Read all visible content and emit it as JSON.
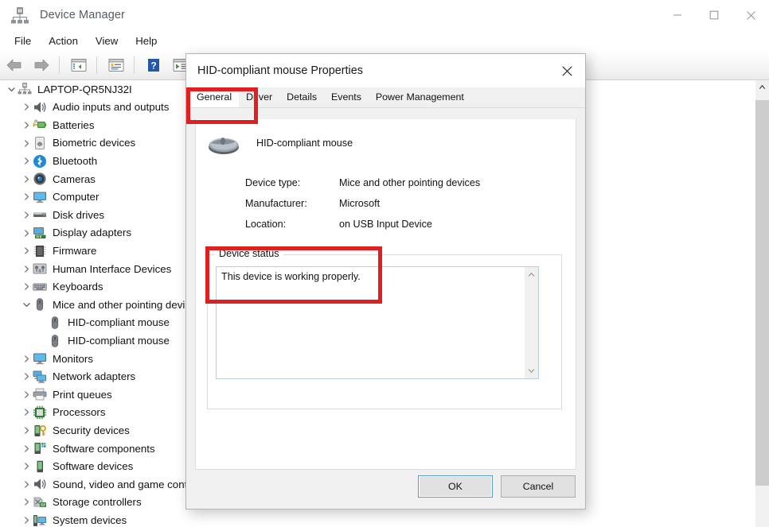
{
  "window": {
    "title": "Device Manager",
    "icon": "device-manager-icon",
    "minimize_label": "Minimize",
    "maximize_label": "Maximize",
    "close_label": "Close"
  },
  "menubar": {
    "items": [
      {
        "label": "File"
      },
      {
        "label": "Action"
      },
      {
        "label": "View"
      },
      {
        "label": "Help"
      }
    ]
  },
  "toolbar": {
    "buttons": [
      {
        "name": "back-arrow-icon",
        "title": "Back"
      },
      {
        "name": "forward-arrow-icon",
        "title": "Forward"
      },
      {
        "name": "show-hide-console-tree-icon",
        "title": "Show/Hide Console Tree"
      },
      {
        "name": "properties-icon",
        "title": "Properties"
      },
      {
        "name": "help-icon",
        "title": "Help"
      },
      {
        "name": "update-driver-icon",
        "title": "Update driver"
      },
      {
        "name": "scan-hardware-changes-icon",
        "title": "Scan for hardware changes"
      }
    ]
  },
  "tree": {
    "root": {
      "label": "LAPTOP-QR5NJ32I",
      "icon": "computer-root-icon",
      "expanded": true
    },
    "items": [
      {
        "label": "Audio inputs and outputs",
        "icon": "speaker-icon",
        "expandable": true,
        "expanded": false,
        "indent": 1
      },
      {
        "label": "Batteries",
        "icon": "battery-icon",
        "expandable": true,
        "expanded": false,
        "indent": 1
      },
      {
        "label": "Biometric devices",
        "icon": "fingerprint-icon",
        "expandable": true,
        "expanded": false,
        "indent": 1
      },
      {
        "label": "Bluetooth",
        "icon": "bluetooth-icon",
        "expandable": true,
        "expanded": false,
        "indent": 1
      },
      {
        "label": "Cameras",
        "icon": "camera-icon",
        "expandable": true,
        "expanded": false,
        "indent": 1
      },
      {
        "label": "Computer",
        "icon": "monitor-icon",
        "expandable": true,
        "expanded": false,
        "indent": 1
      },
      {
        "label": "Disk drives",
        "icon": "disk-drive-icon",
        "expandable": true,
        "expanded": false,
        "indent": 1
      },
      {
        "label": "Display adapters",
        "icon": "display-adapter-icon",
        "expandable": true,
        "expanded": false,
        "indent": 1
      },
      {
        "label": "Firmware",
        "icon": "firmware-chip-icon",
        "expandable": true,
        "expanded": false,
        "indent": 1
      },
      {
        "label": "Human Interface Devices",
        "icon": "hid-icon",
        "expandable": true,
        "expanded": false,
        "indent": 1
      },
      {
        "label": "Keyboards",
        "icon": "keyboard-icon",
        "expandable": true,
        "expanded": false,
        "indent": 1
      },
      {
        "label": "Mice and other pointing devices",
        "icon": "mouse-icon",
        "expandable": true,
        "expanded": true,
        "indent": 1
      },
      {
        "label": "HID-compliant mouse",
        "icon": "mouse-icon",
        "expandable": false,
        "expanded": false,
        "indent": 2
      },
      {
        "label": "HID-compliant mouse",
        "icon": "mouse-icon",
        "expandable": false,
        "expanded": false,
        "indent": 2
      },
      {
        "label": "Monitors",
        "icon": "monitor-icon",
        "expandable": true,
        "expanded": false,
        "indent": 1
      },
      {
        "label": "Network adapters",
        "icon": "network-icon",
        "expandable": true,
        "expanded": false,
        "indent": 1
      },
      {
        "label": "Print queues",
        "icon": "printer-icon",
        "expandable": true,
        "expanded": false,
        "indent": 1
      },
      {
        "label": "Processors",
        "icon": "processor-icon",
        "expandable": true,
        "expanded": false,
        "indent": 1
      },
      {
        "label": "Security devices",
        "icon": "security-key-icon",
        "expandable": true,
        "expanded": false,
        "indent": 1
      },
      {
        "label": "Software components",
        "icon": "software-component-icon",
        "expandable": true,
        "expanded": false,
        "indent": 1
      },
      {
        "label": "Software devices",
        "icon": "software-device-icon",
        "expandable": true,
        "expanded": false,
        "indent": 1
      },
      {
        "label": "Sound, video and game controllers",
        "icon": "speaker-icon",
        "expandable": true,
        "expanded": false,
        "indent": 1
      },
      {
        "label": "Storage controllers",
        "icon": "storage-controller-icon",
        "expandable": true,
        "expanded": false,
        "indent": 1
      },
      {
        "label": "System devices",
        "icon": "system-device-icon",
        "expandable": true,
        "expanded": false,
        "indent": 1
      }
    ]
  },
  "dialog": {
    "title": "HID-compliant mouse Properties",
    "close_label": "Close",
    "tabs": [
      {
        "label": "General",
        "active": true
      },
      {
        "label": "Driver",
        "active": false
      },
      {
        "label": "Details",
        "active": false
      },
      {
        "label": "Events",
        "active": false
      },
      {
        "label": "Power Management",
        "active": false
      }
    ],
    "device": {
      "icon": "mouse-device-icon",
      "name": "HID-compliant mouse",
      "fields": [
        {
          "key": "Device type:",
          "value": "Mice and other pointing devices"
        },
        {
          "key": "Manufacturer:",
          "value": "Microsoft"
        },
        {
          "key": "Location:",
          "value": "on USB Input Device"
        }
      ]
    },
    "status_group": {
      "legend": "Device status",
      "text": "This device is working properly."
    },
    "buttons": {
      "ok": "OK",
      "cancel": "Cancel"
    }
  },
  "annotations": {
    "color": "#e02020",
    "boxes": [
      {
        "name": "highlight-general-tab"
      },
      {
        "name": "highlight-device-status"
      }
    ]
  }
}
